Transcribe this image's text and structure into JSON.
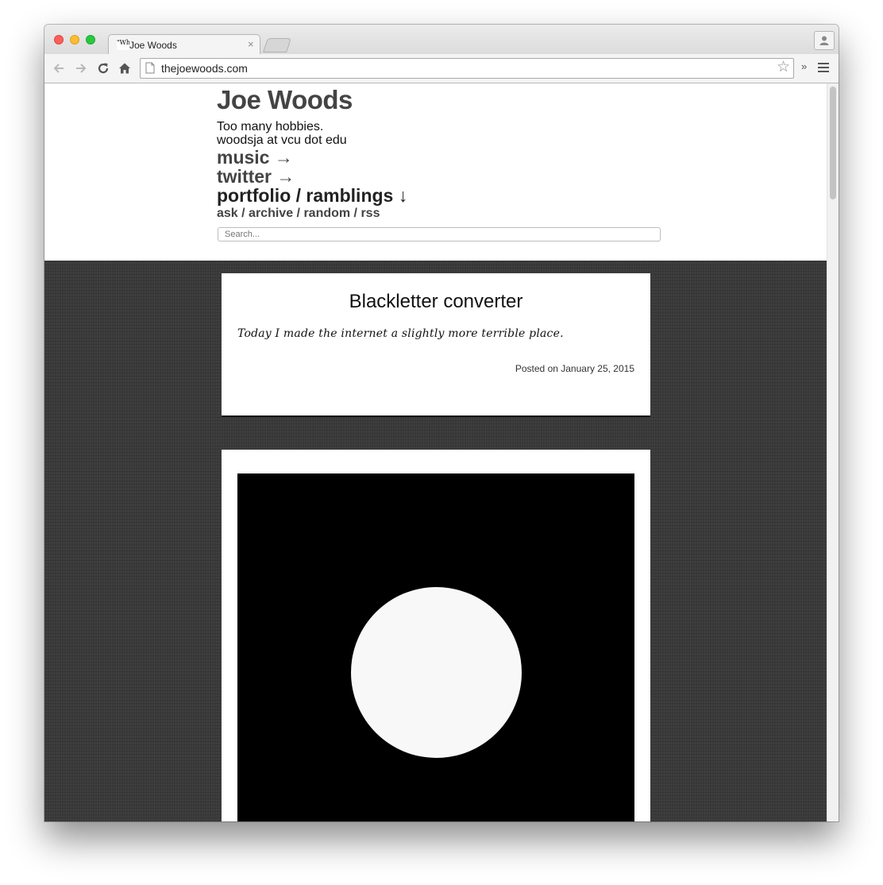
{
  "browser": {
    "tab_favicon_text": "\"Wh",
    "tab_title": "Joe Woods",
    "tab_close": "×",
    "url": "thejoewoods.com",
    "star": "☆",
    "overflow_chevron": "»"
  },
  "site": {
    "title": "Joe Woods",
    "tagline": "Too many hobbies.",
    "email": "woodsja at vcu dot edu",
    "nav": [
      {
        "label": "music →"
      },
      {
        "label": "twitter →"
      },
      {
        "label": "portfolio / ramblings ↓"
      }
    ],
    "subnav": {
      "ask": "ask",
      "archive": "archive",
      "random": "random",
      "rss": "rss",
      "separator": " / "
    },
    "search_placeholder": "Search..."
  },
  "posts": [
    {
      "title": "Blackletter converter",
      "body": "Today I made the internet a slightly more terrible place.",
      "date": "Posted on January 25, 2015"
    }
  ],
  "colors": {
    "traffic_red": "#fc5f57",
    "traffic_yellow": "#fdbc2e",
    "traffic_green": "#28c840",
    "content_background": "#3a3a3a",
    "link_color": "#444444"
  }
}
